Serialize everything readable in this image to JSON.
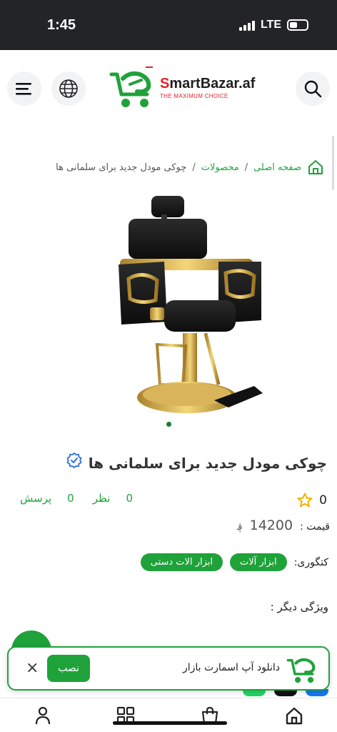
{
  "status_bar": {
    "time": "1:45",
    "network": "LTE"
  },
  "header": {
    "logo_main_prefix": "S",
    "logo_main_rest": "martBazar.af",
    "logo_sub": "THE MAXIMUM CHOICE",
    "menu_icon": "hamburger-icon",
    "language_icon": "globe-icon",
    "search_icon": "search-icon"
  },
  "breadcrumb": {
    "home": "صفحه اصلی",
    "separator": "/",
    "products": "محصولات",
    "current": "چوکی مودل جدید برای سلمانی ها"
  },
  "product": {
    "title": "چوکی مودل جدید برای سلمانی ها",
    "rating": "0",
    "reviews_count": "0",
    "reviews_label": "نظر",
    "questions_count": "0",
    "questions_label": "پرسش",
    "price_label": "قیمت :",
    "price_value": "14200",
    "currency": "؋",
    "category_label": "کتگوری:",
    "categories": [
      "ابزار آلات",
      "ابزار الات دستی"
    ],
    "features_label": "ویژگی دیگر :"
  },
  "app_banner": {
    "text": "دانلود آپ اسمارت بازار",
    "install_label": "نصب",
    "close_label": "×"
  },
  "colors": {
    "brand_green": "#1fa23a",
    "brand_red": "#e0232a",
    "status_bar": "#232427"
  },
  "tabbar": {
    "icons": [
      "user-icon",
      "grid-icon",
      "cart-icon",
      "home-icon"
    ]
  }
}
